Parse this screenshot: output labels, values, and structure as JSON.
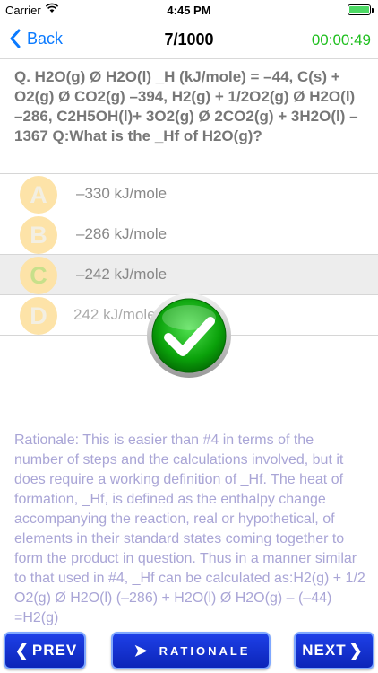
{
  "status": {
    "carrier": "Carrier",
    "time": "4:45 PM"
  },
  "nav": {
    "back_label": "Back",
    "title": "7/1000",
    "timer": "00:00:49"
  },
  "question": "Q. H2O(g) Ø H2O(l) _H (kJ/mole) = –44, C(s) + O2(g) Ø CO2(g) –394, H2(g) + 1/2O2(g) Ø H2O(l) –286, C2H5OH(l)+ 3O2(g) Ø 2CO2(g) + 3H2O(l) –1367 Q:What is the _Hf of H2O(g)?",
  "answers": [
    {
      "letter": "A",
      "text": "–330 kJ/mole"
    },
    {
      "letter": "B",
      "text": "–286 kJ/mole"
    },
    {
      "letter": "C",
      "text": "–242 kJ/mole"
    },
    {
      "letter": "D",
      "text": "242 kJ/mole"
    }
  ],
  "rationale": "Rationale: This is easier than #4 in terms of the number of steps and the calculations involved, but it does require a working definition of _Hf. The heat of formation, _Hf, is defined as the enthalpy change accompanying the reaction, real or hypothetical, of elements in their standard states coming together to form the product in question. Thus in a manner similar to that used in #4, _Hf can be calculated as:H2(g) + 1/2 O2(g) Ø H2O(l) (–286) + H2O(l) Ø H2O(g) – (–44) =H2(g)",
  "buttons": {
    "prev": "PREV",
    "rationale": "RATIONALE",
    "next": "NEXT"
  },
  "icons": {
    "wifi": "wifi-icon",
    "battery": "battery-icon",
    "back": "chevron-left-icon",
    "check": "checkmark-icon"
  },
  "colors": {
    "accent_blue": "#0a7aff",
    "timer_green": "#1fbf1f",
    "button_blue": "#1233d6",
    "rationale_text": "#a9a5d6"
  },
  "state": {
    "selected_answer": "C",
    "result": "correct"
  }
}
